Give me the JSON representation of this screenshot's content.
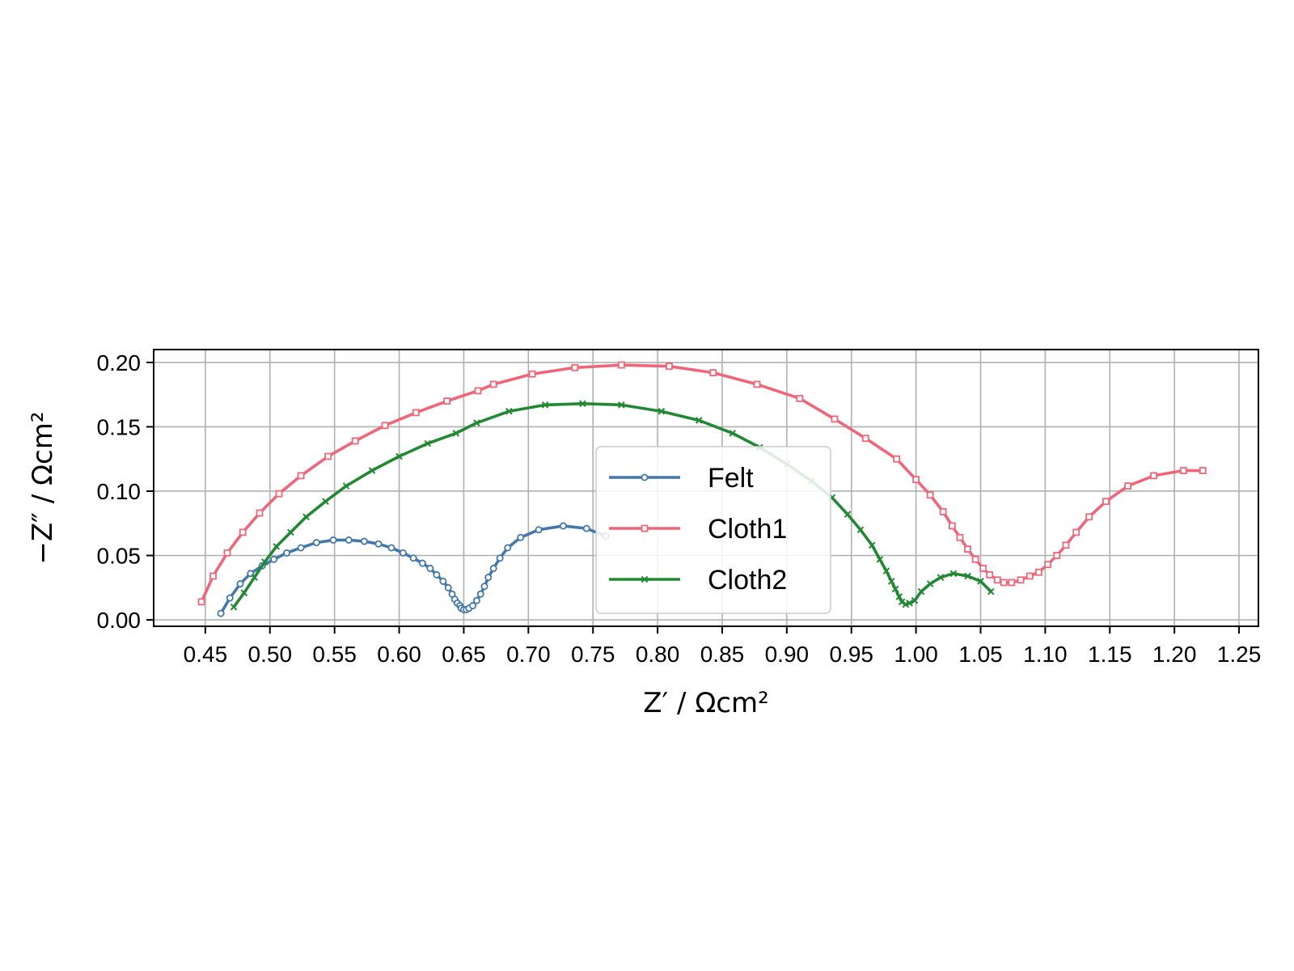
{
  "chart_data": {
    "type": "line",
    "xlabel": "Z′ / Ωcm²",
    "ylabel": "−Z″ / Ωcm²",
    "xlim": [
      0.41,
      1.265
    ],
    "ylim": [
      -0.005,
      0.21
    ],
    "xticks": [
      "0.45",
      "0.50",
      "0.55",
      "0.60",
      "0.65",
      "0.70",
      "0.75",
      "0.80",
      "0.85",
      "0.90",
      "0.95",
      "1.00",
      "1.05",
      "1.10",
      "1.15",
      "1.20",
      "1.25"
    ],
    "yticks": [
      "0.00",
      "0.05",
      "0.10",
      "0.15",
      "0.20"
    ],
    "grid": true,
    "legend_position": "center",
    "series": [
      {
        "name": "Felt",
        "color": "#4477AA",
        "marker": "circle",
        "points": [
          [
            0.462,
            0.005
          ],
          [
            0.469,
            0.017
          ],
          [
            0.477,
            0.028
          ],
          [
            0.485,
            0.036
          ],
          [
            0.494,
            0.042
          ],
          [
            0.503,
            0.047
          ],
          [
            0.513,
            0.052
          ],
          [
            0.524,
            0.056
          ],
          [
            0.536,
            0.06
          ],
          [
            0.549,
            0.062
          ],
          [
            0.561,
            0.062
          ],
          [
            0.573,
            0.061
          ],
          [
            0.584,
            0.059
          ],
          [
            0.594,
            0.056
          ],
          [
            0.603,
            0.052
          ],
          [
            0.611,
            0.048
          ],
          [
            0.618,
            0.044
          ],
          [
            0.624,
            0.04
          ],
          [
            0.629,
            0.035
          ],
          [
            0.634,
            0.03
          ],
          [
            0.638,
            0.025
          ],
          [
            0.641,
            0.02
          ],
          [
            0.643,
            0.016
          ],
          [
            0.645,
            0.013
          ],
          [
            0.647,
            0.011
          ],
          [
            0.648,
            0.009
          ],
          [
            0.65,
            0.008
          ],
          [
            0.652,
            0.008
          ],
          [
            0.654,
            0.009
          ],
          [
            0.657,
            0.011
          ],
          [
            0.66,
            0.015
          ],
          [
            0.663,
            0.02
          ],
          [
            0.666,
            0.026
          ],
          [
            0.669,
            0.033
          ],
          [
            0.673,
            0.04
          ],
          [
            0.678,
            0.048
          ],
          [
            0.684,
            0.056
          ],
          [
            0.694,
            0.064
          ],
          [
            0.708,
            0.07
          ],
          [
            0.727,
            0.073
          ],
          [
            0.745,
            0.071
          ],
          [
            0.76,
            0.065
          ]
        ]
      },
      {
        "name": "Cloth1",
        "color": "#EE6677",
        "marker": "square",
        "points": [
          [
            0.447,
            0.014
          ],
          [
            0.456,
            0.034
          ],
          [
            0.467,
            0.052
          ],
          [
            0.479,
            0.068
          ],
          [
            0.492,
            0.083
          ],
          [
            0.507,
            0.098
          ],
          [
            0.524,
            0.112
          ],
          [
            0.545,
            0.127
          ],
          [
            0.566,
            0.139
          ],
          [
            0.589,
            0.151
          ],
          [
            0.613,
            0.161
          ],
          [
            0.637,
            0.17
          ],
          [
            0.661,
            0.178
          ],
          [
            0.673,
            0.183
          ],
          [
            0.703,
            0.191
          ],
          [
            0.736,
            0.196
          ],
          [
            0.772,
            0.198
          ],
          [
            0.809,
            0.197
          ],
          [
            0.843,
            0.192
          ],
          [
            0.877,
            0.183
          ],
          [
            0.91,
            0.172
          ],
          [
            0.937,
            0.156
          ],
          [
            0.961,
            0.141
          ],
          [
            0.985,
            0.125
          ],
          [
            1.0,
            0.109
          ],
          [
            1.011,
            0.097
          ],
          [
            1.021,
            0.084
          ],
          [
            1.028,
            0.073
          ],
          [
            1.034,
            0.064
          ],
          [
            1.04,
            0.055
          ],
          [
            1.046,
            0.047
          ],
          [
            1.052,
            0.04
          ],
          [
            1.057,
            0.035
          ],
          [
            1.063,
            0.031
          ],
          [
            1.068,
            0.029
          ],
          [
            1.074,
            0.029
          ],
          [
            1.081,
            0.031
          ],
          [
            1.088,
            0.034
          ],
          [
            1.095,
            0.037
          ],
          [
            1.102,
            0.043
          ],
          [
            1.109,
            0.05
          ],
          [
            1.116,
            0.058
          ],
          [
            1.124,
            0.068
          ],
          [
            1.134,
            0.08
          ],
          [
            1.147,
            0.092
          ],
          [
            1.164,
            0.104
          ],
          [
            1.184,
            0.112
          ],
          [
            1.207,
            0.116
          ],
          [
            1.222,
            0.116
          ]
        ]
      },
      {
        "name": "Cloth2",
        "color": "#228833",
        "marker": "x",
        "points": [
          [
            0.472,
            0.01
          ],
          [
            0.48,
            0.021
          ],
          [
            0.488,
            0.033
          ],
          [
            0.496,
            0.045
          ],
          [
            0.505,
            0.057
          ],
          [
            0.516,
            0.068
          ],
          [
            0.528,
            0.08
          ],
          [
            0.543,
            0.092
          ],
          [
            0.559,
            0.104
          ],
          [
            0.579,
            0.116
          ],
          [
            0.6,
            0.127
          ],
          [
            0.622,
            0.137
          ],
          [
            0.644,
            0.145
          ],
          [
            0.66,
            0.153
          ],
          [
            0.685,
            0.162
          ],
          [
            0.713,
            0.167
          ],
          [
            0.742,
            0.168
          ],
          [
            0.772,
            0.167
          ],
          [
            0.803,
            0.162
          ],
          [
            0.832,
            0.155
          ],
          [
            0.858,
            0.145
          ],
          [
            0.879,
            0.134
          ],
          [
            0.9,
            0.121
          ],
          [
            0.919,
            0.108
          ],
          [
            0.935,
            0.095
          ],
          [
            0.947,
            0.082
          ],
          [
            0.957,
            0.07
          ],
          [
            0.966,
            0.058
          ],
          [
            0.972,
            0.047
          ],
          [
            0.977,
            0.038
          ],
          [
            0.981,
            0.03
          ],
          [
            0.984,
            0.024
          ],
          [
            0.987,
            0.018
          ],
          [
            0.989,
            0.014
          ],
          [
            0.992,
            0.012
          ],
          [
            0.995,
            0.013
          ],
          [
            0.999,
            0.015
          ],
          [
            1.004,
            0.022
          ],
          [
            1.011,
            0.028
          ],
          [
            1.019,
            0.033
          ],
          [
            1.029,
            0.036
          ],
          [
            1.04,
            0.034
          ],
          [
            1.05,
            0.03
          ],
          [
            1.058,
            0.022
          ]
        ]
      }
    ]
  }
}
